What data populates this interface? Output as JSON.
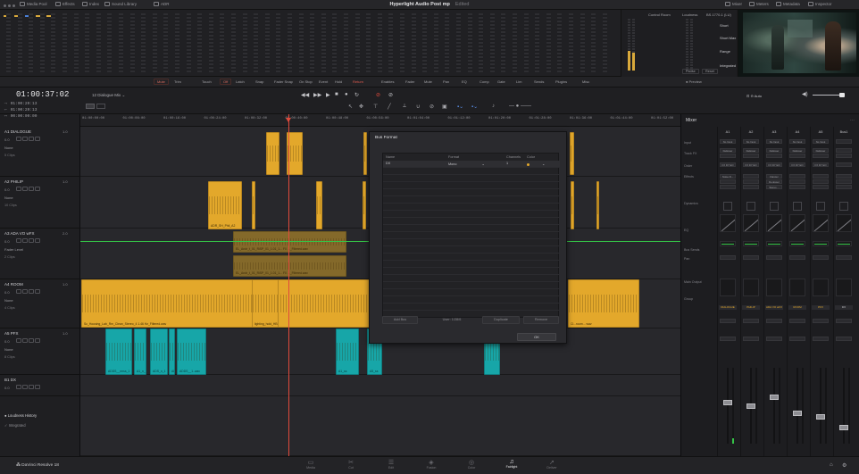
{
  "titlebar": {
    "media_pool": "Media Pool",
    "effects": "Effects",
    "index": "Index",
    "sound_library": "Sound Library",
    "adr": "ADR",
    "project_title": "Hyperlight Audio Post mp",
    "edited": "Edited",
    "meters": "Mixer",
    "meters2": "Meters",
    "metadata": "Metadata",
    "inspector": "Inspector"
  },
  "control_room": {
    "label": "Control Room",
    "loudness_label": "Loudness",
    "bs_label": "BS.1770-1 (LU)",
    "ch_labels": [
      "CR",
      "M1",
      "M2",
      "SM",
      "SS"
    ],
    "buttons": [
      "Short",
      "Short Max",
      "Range",
      "Integrated"
    ],
    "pause": "Pause",
    "reset": "Reset"
  },
  "edit_toolbar": {
    "items": [
      {
        "label": "Mute",
        "style": "boxed"
      },
      {
        "label": "Trim",
        "style": ""
      },
      {
        "label": "Touch",
        "style": ""
      },
      {
        "label": "Off",
        "style": "boxed"
      },
      {
        "label": "Latch",
        "style": ""
      },
      {
        "label": "Snap",
        "style": ""
      },
      {
        "label": "Fader Snap",
        "style": ""
      },
      {
        "label": "On Stop",
        "style": ""
      },
      {
        "label": "Event",
        "style": ""
      },
      {
        "label": "Hold",
        "style": ""
      },
      {
        "label": "Return",
        "style": "red"
      },
      {
        "label": "Enables",
        "style": ""
      },
      {
        "label": "Fader",
        "style": ""
      },
      {
        "label": "Mute",
        "style": ""
      },
      {
        "label": "Pan",
        "style": ""
      },
      {
        "label": "EQ",
        "style": ""
      },
      {
        "label": "Comp",
        "style": ""
      },
      {
        "label": "Gate",
        "style": ""
      },
      {
        "label": "Lim",
        "style": ""
      },
      {
        "label": "Sends",
        "style": ""
      },
      {
        "label": "Plugins",
        "style": ""
      },
      {
        "label": "Misc",
        "style": ""
      }
    ],
    "preview": "Preview"
  },
  "transport": {
    "timecode": "01:00:37:02",
    "timeline_name": "12 Dialogue Mix",
    "sub_timecodes": [
      "01:00:20:13",
      "01:00:20:13",
      "00:00:00:00"
    ],
    "zoom": "Auto"
  },
  "tracks": [
    {
      "id": "A1",
      "name": "DIALOGUE",
      "fmt": "1.0",
      "vol": "0.0",
      "automation": "None",
      "clips": "5 Clips"
    },
    {
      "id": "A2",
      "name": "PHILIP",
      "fmt": "1.0",
      "vol": "0.0",
      "automation": "None",
      "clips": "10 Clips"
    },
    {
      "id": "A3",
      "name": "ADA VO wFX",
      "fmt": "2.0",
      "vol": "0.0",
      "automation": "Fader Level",
      "clips": "2 Clips"
    },
    {
      "id": "A4",
      "name": "ROOM",
      "fmt": "1.0",
      "vol": "0.0",
      "automation": "None",
      "clips": "4 Clips"
    },
    {
      "id": "A5",
      "name": "PFX",
      "fmt": "1.0",
      "vol": "0.0",
      "automation": "None",
      "clips": "8 Clips"
    },
    {
      "id": "B1",
      "name": "DX",
      "fmt": "",
      "vol": "0.0",
      "automation": "None",
      "clips": ""
    }
  ],
  "loudness": {
    "history": "Loudness History",
    "integrated": "Integrated"
  },
  "ruler_ticks": [
    "01:00:00:00",
    "01:00:08:00",
    "01:00:16:00",
    "01:00:24:00",
    "01:00:32:00",
    "01:00:40:00",
    "01:00:48:00",
    "01:00:56:00",
    "01:01:04:00",
    "01:01:12:00",
    "01:01:20:00",
    "01:01:28:00",
    "01:01:36:00",
    "01:01:44:00",
    "01:01:52:00"
  ],
  "clip_labels": {
    "a2_clip": "ADR_SH_Phil_A2",
    "a3_clip1": "EL_Andr_t_01_RiSP_01_1.01_1... F0  ..._Filtered.wav",
    "a3_clip2": "EL_Andr_t_01_RiSP_01_1.01_1... F0  ..._Filtered.wav",
    "a4_clip1": "Sc_Housing_Lab_Rm_Clean_Stereo_4 1.46 Hz_Filtered.wav",
    "a4_clip2": "lighting_hold_HB..._Filtered.wav",
    "a4_clip3": "Cl...room... wav",
    "a5_clips": [
      "ADDS__rmss_1",
      "A1_n_1",
      "ADS_n_1",
      "ADDS_2_dFraws",
      "ADDS__1..wav",
      "A1_ss",
      "A5_ss"
    ]
  },
  "bus_dialog": {
    "title": "Bus Format",
    "col_name": "Name",
    "col_format": "Format",
    "col_channels": "Channels",
    "col_color": "Color",
    "row_name": "DX",
    "row_format": "Mono",
    "row_channels": "1",
    "add_bus": "Add Bus",
    "user": "User: 1/28/6",
    "duplicate": "Duplicate",
    "remove": "Remove",
    "ok": "OK"
  },
  "mixer": {
    "title": "Mixer",
    "channels": [
      "A1",
      "A2",
      "A3",
      "A4",
      "A5",
      "Bus1"
    ],
    "row_labels": [
      "Input",
      "Track FX",
      "Order",
      "Effects",
      "Dynamics",
      "EQ",
      "Bus Sends",
      "Pan",
      "Main Output",
      "Group"
    ],
    "input_slots": [
      "No Input",
      "No Input",
      "No Input",
      "No Input",
      "No Input",
      ""
    ],
    "fx_slots": [
      "DeEsser",
      "DeEsser",
      "DeEsser",
      "DeEsser",
      "DeEsser",
      ""
    ],
    "order_slots": [
      "FX DY EQ",
      "FX DY EQ",
      "FX DY EQ",
      "FX DY EQ",
      "FX DY EQ",
      ""
    ],
    "names": [
      "DIALOGUE",
      "PHILIP",
      "ADA VO wFX",
      "ROOM",
      "PFX",
      "DX"
    ],
    "fader_levels": [
      0.55,
      0.5,
      0.62,
      0.4,
      0.35,
      0.2
    ],
    "effects_names": [
      "Noise R...",
      "",
      "Flanger",
      "",
      "",
      ""
    ],
    "effects_names2": [
      "",
      "",
      "De-Esser",
      "",
      "",
      ""
    ],
    "effects_names3": [
      "",
      "",
      "Stereo ...",
      "",
      "",
      ""
    ]
  },
  "pages": [
    {
      "label": "Media",
      "icon": "▭",
      "active": false
    },
    {
      "label": "Cut",
      "icon": "✂",
      "active": false
    },
    {
      "label": "Edit",
      "icon": "☰",
      "active": false
    },
    {
      "label": "Fusion",
      "icon": "◈",
      "active": false
    },
    {
      "label": "Color",
      "icon": "◎",
      "active": false
    },
    {
      "label": "Fairlight",
      "icon": "♫",
      "active": true
    },
    {
      "label": "Deliver",
      "icon": "➚",
      "active": false
    }
  ],
  "app_brand": "DaVinci Resolve 18",
  "colors": {
    "clip_yellow": "#e3a82b",
    "clip_cyan": "#17a6a8",
    "playhead": "#e04a3c",
    "automation": "#35c447"
  }
}
